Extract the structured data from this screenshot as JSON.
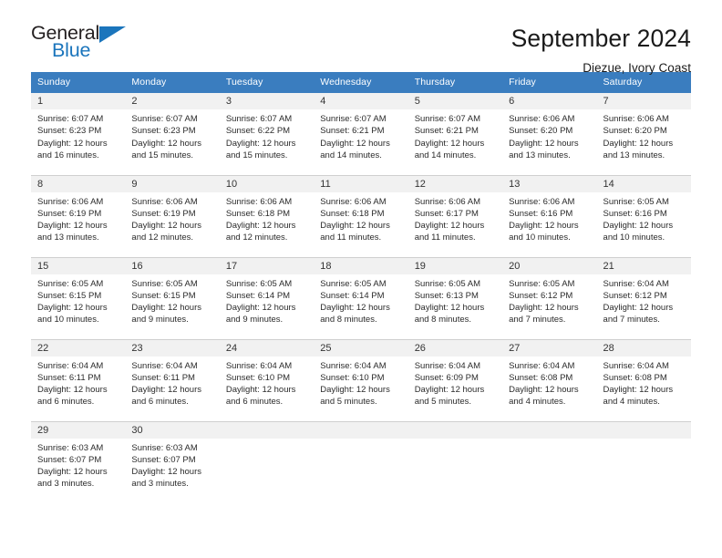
{
  "brand": {
    "name_part1": "General",
    "name_part2": "Blue",
    "triangle_icon": "triangle-icon",
    "color_blue": "#1b75bc",
    "color_dark": "#231f20"
  },
  "header": {
    "title": "September 2024",
    "subtitle": "Diezue, Ivory Coast"
  },
  "calendar": {
    "header_bg": "#3a7dbf",
    "daynum_bg": "#f1f1f1",
    "weekdays": [
      "Sunday",
      "Monday",
      "Tuesday",
      "Wednesday",
      "Thursday",
      "Friday",
      "Saturday"
    ],
    "weeks": [
      [
        {
          "day": "1",
          "sunrise": "Sunrise: 6:07 AM",
          "sunset": "Sunset: 6:23 PM",
          "daylight_line1": "Daylight: 12 hours",
          "daylight_line2": "and 16 minutes."
        },
        {
          "day": "2",
          "sunrise": "Sunrise: 6:07 AM",
          "sunset": "Sunset: 6:23 PM",
          "daylight_line1": "Daylight: 12 hours",
          "daylight_line2": "and 15 minutes."
        },
        {
          "day": "3",
          "sunrise": "Sunrise: 6:07 AM",
          "sunset": "Sunset: 6:22 PM",
          "daylight_line1": "Daylight: 12 hours",
          "daylight_line2": "and 15 minutes."
        },
        {
          "day": "4",
          "sunrise": "Sunrise: 6:07 AM",
          "sunset": "Sunset: 6:21 PM",
          "daylight_line1": "Daylight: 12 hours",
          "daylight_line2": "and 14 minutes."
        },
        {
          "day": "5",
          "sunrise": "Sunrise: 6:07 AM",
          "sunset": "Sunset: 6:21 PM",
          "daylight_line1": "Daylight: 12 hours",
          "daylight_line2": "and 14 minutes."
        },
        {
          "day": "6",
          "sunrise": "Sunrise: 6:06 AM",
          "sunset": "Sunset: 6:20 PM",
          "daylight_line1": "Daylight: 12 hours",
          "daylight_line2": "and 13 minutes."
        },
        {
          "day": "7",
          "sunrise": "Sunrise: 6:06 AM",
          "sunset": "Sunset: 6:20 PM",
          "daylight_line1": "Daylight: 12 hours",
          "daylight_line2": "and 13 minutes."
        }
      ],
      [
        {
          "day": "8",
          "sunrise": "Sunrise: 6:06 AM",
          "sunset": "Sunset: 6:19 PM",
          "daylight_line1": "Daylight: 12 hours",
          "daylight_line2": "and 13 minutes."
        },
        {
          "day": "9",
          "sunrise": "Sunrise: 6:06 AM",
          "sunset": "Sunset: 6:19 PM",
          "daylight_line1": "Daylight: 12 hours",
          "daylight_line2": "and 12 minutes."
        },
        {
          "day": "10",
          "sunrise": "Sunrise: 6:06 AM",
          "sunset": "Sunset: 6:18 PM",
          "daylight_line1": "Daylight: 12 hours",
          "daylight_line2": "and 12 minutes."
        },
        {
          "day": "11",
          "sunrise": "Sunrise: 6:06 AM",
          "sunset": "Sunset: 6:18 PM",
          "daylight_line1": "Daylight: 12 hours",
          "daylight_line2": "and 11 minutes."
        },
        {
          "day": "12",
          "sunrise": "Sunrise: 6:06 AM",
          "sunset": "Sunset: 6:17 PM",
          "daylight_line1": "Daylight: 12 hours",
          "daylight_line2": "and 11 minutes."
        },
        {
          "day": "13",
          "sunrise": "Sunrise: 6:06 AM",
          "sunset": "Sunset: 6:16 PM",
          "daylight_line1": "Daylight: 12 hours",
          "daylight_line2": "and 10 minutes."
        },
        {
          "day": "14",
          "sunrise": "Sunrise: 6:05 AM",
          "sunset": "Sunset: 6:16 PM",
          "daylight_line1": "Daylight: 12 hours",
          "daylight_line2": "and 10 minutes."
        }
      ],
      [
        {
          "day": "15",
          "sunrise": "Sunrise: 6:05 AM",
          "sunset": "Sunset: 6:15 PM",
          "daylight_line1": "Daylight: 12 hours",
          "daylight_line2": "and 10 minutes."
        },
        {
          "day": "16",
          "sunrise": "Sunrise: 6:05 AM",
          "sunset": "Sunset: 6:15 PM",
          "daylight_line1": "Daylight: 12 hours",
          "daylight_line2": "and 9 minutes."
        },
        {
          "day": "17",
          "sunrise": "Sunrise: 6:05 AM",
          "sunset": "Sunset: 6:14 PM",
          "daylight_line1": "Daylight: 12 hours",
          "daylight_line2": "and 9 minutes."
        },
        {
          "day": "18",
          "sunrise": "Sunrise: 6:05 AM",
          "sunset": "Sunset: 6:14 PM",
          "daylight_line1": "Daylight: 12 hours",
          "daylight_line2": "and 8 minutes."
        },
        {
          "day": "19",
          "sunrise": "Sunrise: 6:05 AM",
          "sunset": "Sunset: 6:13 PM",
          "daylight_line1": "Daylight: 12 hours",
          "daylight_line2": "and 8 minutes."
        },
        {
          "day": "20",
          "sunrise": "Sunrise: 6:05 AM",
          "sunset": "Sunset: 6:12 PM",
          "daylight_line1": "Daylight: 12 hours",
          "daylight_line2": "and 7 minutes."
        },
        {
          "day": "21",
          "sunrise": "Sunrise: 6:04 AM",
          "sunset": "Sunset: 6:12 PM",
          "daylight_line1": "Daylight: 12 hours",
          "daylight_line2": "and 7 minutes."
        }
      ],
      [
        {
          "day": "22",
          "sunrise": "Sunrise: 6:04 AM",
          "sunset": "Sunset: 6:11 PM",
          "daylight_line1": "Daylight: 12 hours",
          "daylight_line2": "and 6 minutes."
        },
        {
          "day": "23",
          "sunrise": "Sunrise: 6:04 AM",
          "sunset": "Sunset: 6:11 PM",
          "daylight_line1": "Daylight: 12 hours",
          "daylight_line2": "and 6 minutes."
        },
        {
          "day": "24",
          "sunrise": "Sunrise: 6:04 AM",
          "sunset": "Sunset: 6:10 PM",
          "daylight_line1": "Daylight: 12 hours",
          "daylight_line2": "and 6 minutes."
        },
        {
          "day": "25",
          "sunrise": "Sunrise: 6:04 AM",
          "sunset": "Sunset: 6:10 PM",
          "daylight_line1": "Daylight: 12 hours",
          "daylight_line2": "and 5 minutes."
        },
        {
          "day": "26",
          "sunrise": "Sunrise: 6:04 AM",
          "sunset": "Sunset: 6:09 PM",
          "daylight_line1": "Daylight: 12 hours",
          "daylight_line2": "and 5 minutes."
        },
        {
          "day": "27",
          "sunrise": "Sunrise: 6:04 AM",
          "sunset": "Sunset: 6:08 PM",
          "daylight_line1": "Daylight: 12 hours",
          "daylight_line2": "and 4 minutes."
        },
        {
          "day": "28",
          "sunrise": "Sunrise: 6:04 AM",
          "sunset": "Sunset: 6:08 PM",
          "daylight_line1": "Daylight: 12 hours",
          "daylight_line2": "and 4 minutes."
        }
      ],
      [
        {
          "day": "29",
          "sunrise": "Sunrise: 6:03 AM",
          "sunset": "Sunset: 6:07 PM",
          "daylight_line1": "Daylight: 12 hours",
          "daylight_line2": "and 3 minutes."
        },
        {
          "day": "30",
          "sunrise": "Sunrise: 6:03 AM",
          "sunset": "Sunset: 6:07 PM",
          "daylight_line1": "Daylight: 12 hours",
          "daylight_line2": "and 3 minutes."
        },
        {
          "day": "",
          "sunrise": "",
          "sunset": "",
          "daylight_line1": "",
          "daylight_line2": ""
        },
        {
          "day": "",
          "sunrise": "",
          "sunset": "",
          "daylight_line1": "",
          "daylight_line2": ""
        },
        {
          "day": "",
          "sunrise": "",
          "sunset": "",
          "daylight_line1": "",
          "daylight_line2": ""
        },
        {
          "day": "",
          "sunrise": "",
          "sunset": "",
          "daylight_line1": "",
          "daylight_line2": ""
        },
        {
          "day": "",
          "sunrise": "",
          "sunset": "",
          "daylight_line1": "",
          "daylight_line2": ""
        }
      ]
    ]
  }
}
